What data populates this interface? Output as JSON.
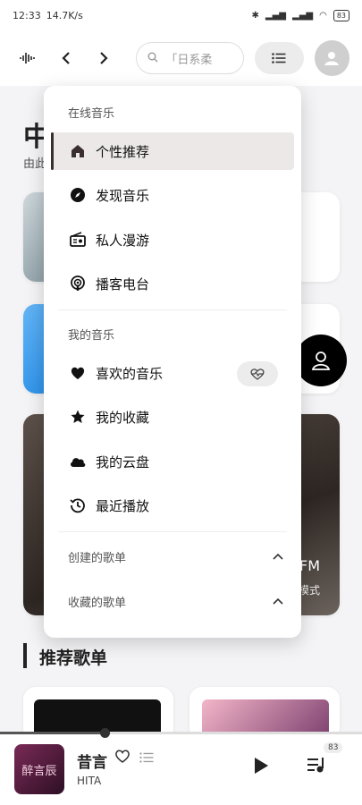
{
  "status": {
    "time": "12:33",
    "speed": "14.7K/s",
    "battery": "83"
  },
  "topbar": {
    "search_placeholder": "「日系柔"
  },
  "background": {
    "title": "中",
    "subtitle": "由此",
    "fm_label": "FM",
    "mode_label": "模式",
    "recommend_title": "推荐歌单"
  },
  "menu": {
    "online_header": "在线音乐",
    "online_items": [
      {
        "label": "个性推荐",
        "icon": "home-icon",
        "active": true
      },
      {
        "label": "发现音乐",
        "icon": "compass-icon"
      },
      {
        "label": "私人漫游",
        "icon": "radio-icon"
      },
      {
        "label": "播客电台",
        "icon": "podcast-icon"
      }
    ],
    "my_header": "我的音乐",
    "my_items": [
      {
        "label": "喜欢的音乐",
        "icon": "heart-icon"
      },
      {
        "label": "我的收藏",
        "icon": "star-icon"
      },
      {
        "label": "我的云盘",
        "icon": "cloud-icon"
      },
      {
        "label": "最近播放",
        "icon": "history-icon"
      }
    ],
    "created_playlists": "创建的歌单",
    "collected_playlists": "收藏的歌单"
  },
  "player": {
    "song": "昔言",
    "artist": "HITA",
    "queue_count": "83",
    "cover_text": "醉言辰",
    "progress": 0.29
  }
}
